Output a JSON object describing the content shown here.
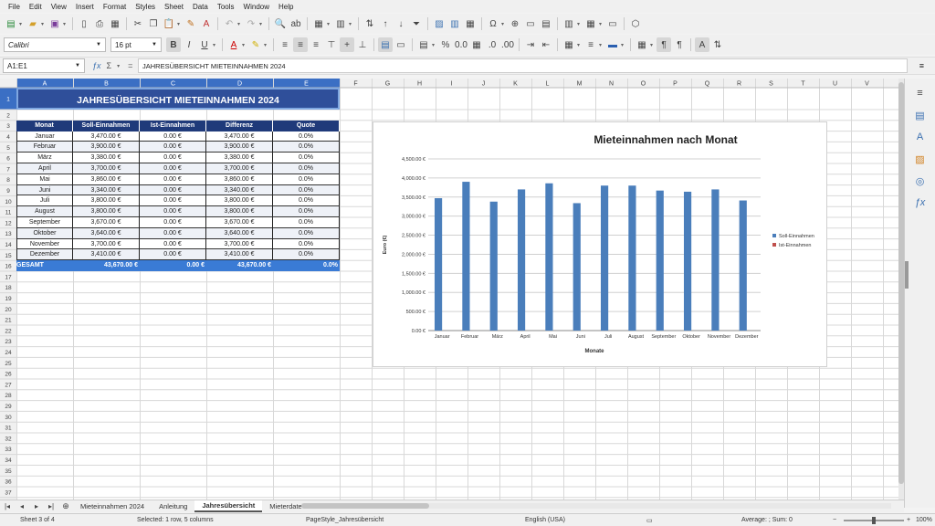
{
  "menu": [
    "File",
    "Edit",
    "View",
    "Insert",
    "Format",
    "Styles",
    "Sheet",
    "Data",
    "Tools",
    "Window",
    "Help"
  ],
  "toolbar": {
    "font_name": "Calibri",
    "font_size": "16 pt"
  },
  "formula_bar": {
    "name_box": "A1:E1",
    "content": "JAHRESÜBERSICHT MIETEINNAHMEN 2024"
  },
  "columns": [
    "A",
    "B",
    "C",
    "D",
    "E",
    "F",
    "G",
    "H",
    "I",
    "J",
    "K",
    "L",
    "M",
    "N",
    "O",
    "P",
    "Q",
    "R",
    "S",
    "T",
    "U",
    "V"
  ],
  "rows_visible": 38,
  "sheet": {
    "title": "JAHRESÜBERSICHT MIETEINNAHMEN 2024",
    "headers": [
      "Monat",
      "Soll-Einnahmen",
      "Ist-Einnahmen",
      "Differenz",
      "Quote"
    ],
    "rows": [
      [
        "Januar",
        "3,470.00 €",
        "0.00 €",
        "3,470.00 €",
        "0.0%"
      ],
      [
        "Februar",
        "3,900.00 €",
        "0.00 €",
        "3,900.00 €",
        "0.0%"
      ],
      [
        "März",
        "3,380.00 €",
        "0.00 €",
        "3,380.00 €",
        "0.0%"
      ],
      [
        "April",
        "3,700.00 €",
        "0.00 €",
        "3,700.00 €",
        "0.0%"
      ],
      [
        "Mai",
        "3,860.00 €",
        "0.00 €",
        "3,860.00 €",
        "0.0%"
      ],
      [
        "Juni",
        "3,340.00 €",
        "0.00 €",
        "3,340.00 €",
        "0.0%"
      ],
      [
        "Juli",
        "3,800.00 €",
        "0.00 €",
        "3,800.00 €",
        "0.0%"
      ],
      [
        "August",
        "3,800.00 €",
        "0.00 €",
        "3,800.00 €",
        "0.0%"
      ],
      [
        "September",
        "3,670.00 €",
        "0.00 €",
        "3,670.00 €",
        "0.0%"
      ],
      [
        "Oktober",
        "3,640.00 €",
        "0.00 €",
        "3,640.00 €",
        "0.0%"
      ],
      [
        "November",
        "3,700.00 €",
        "0.00 €",
        "3,700.00 €",
        "0.0%"
      ],
      [
        "Dezember",
        "3,410.00 €",
        "0.00 €",
        "3,410.00 €",
        "0.0%"
      ]
    ],
    "total": [
      "GESAMT",
      "43,670.00 €",
      "0.00 €",
      "43,670.00 €",
      "0.0%"
    ]
  },
  "colors": {
    "title_bg": "#2f4f9a",
    "header_bg": "#1f3a7a",
    "total_bg": "#3a7bd5",
    "series1": "#4a7ebb",
    "series2": "#c0504d",
    "selection": "#3b6fc4"
  },
  "chart_data": {
    "type": "bar",
    "title": "Mieteinnahmen nach Monat",
    "xlabel": "Monate",
    "ylabel": "Euro (€)",
    "categories": [
      "Januar",
      "Februar",
      "März",
      "April",
      "Mai",
      "Juni",
      "Juli",
      "August",
      "September",
      "Oktober",
      "November",
      "Dezember"
    ],
    "series": [
      {
        "name": "Soll-Einnahmen",
        "values": [
          3470,
          3900,
          3380,
          3700,
          3860,
          3340,
          3800,
          3800,
          3670,
          3640,
          3700,
          3410
        ]
      },
      {
        "name": "Ist-Einnahmen",
        "values": [
          0,
          0,
          0,
          0,
          0,
          0,
          0,
          0,
          0,
          0,
          0,
          0
        ]
      }
    ],
    "ylim": [
      0,
      4500
    ],
    "yticks": [
      "0.00 €",
      "500.00 €",
      "1,000.00 €",
      "1,500.00 €",
      "2,000.00 €",
      "2,500.00 €",
      "3,000.00 €",
      "3,500.00 €",
      "4,000.00 €",
      "4,500.00 €"
    ],
    "grid": true,
    "legend": "right"
  },
  "tabs": [
    {
      "label": "Mieteinnahmen 2024",
      "active": false
    },
    {
      "label": "Anleitung",
      "active": false
    },
    {
      "label": "Jahresübersicht",
      "active": true
    },
    {
      "label": "Mieterdaten",
      "active": false
    }
  ],
  "status": {
    "sheet": "Sheet 3 of 4",
    "selection": "Selected: 1 row, 5 columns",
    "page_style": "PageStyle_Jahresübersicht",
    "language": "English (USA)",
    "sum_info": "Average: ; Sum: 0",
    "zoom": "100%"
  }
}
